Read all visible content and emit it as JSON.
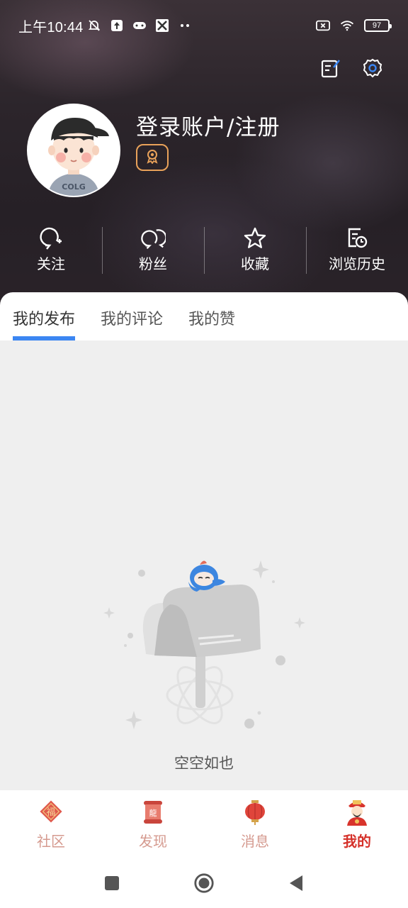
{
  "status_bar": {
    "time": "上午10:44",
    "battery": "97"
  },
  "profile": {
    "login_title": "登录账户/注册",
    "avatar_text": "COLG"
  },
  "stats": [
    {
      "label": "关注",
      "icon": "follow-icon"
    },
    {
      "label": "粉丝",
      "icon": "fans-icon"
    },
    {
      "label": "收藏",
      "icon": "star-icon"
    },
    {
      "label": "浏览历史",
      "icon": "history-icon"
    }
  ],
  "tabs": [
    {
      "label": "我的发布",
      "active": true
    },
    {
      "label": "我的评论",
      "active": false
    },
    {
      "label": "我的赞",
      "active": false
    }
  ],
  "empty_state": {
    "text": "空空如也"
  },
  "bottom_nav": [
    {
      "label": "社区",
      "icon": "community-fu-icon",
      "active": false
    },
    {
      "label": "发现",
      "icon": "discover-scroll-icon",
      "active": false
    },
    {
      "label": "消息",
      "icon": "lantern-icon",
      "active": false
    },
    {
      "label": "我的",
      "icon": "mine-caishen-icon",
      "active": true
    }
  ],
  "colors": {
    "accent_blue": "#3b86f2",
    "nav_active": "#d5312a",
    "nav_inactive": "#d59a8f",
    "badge_orange": "#e9a25a"
  }
}
